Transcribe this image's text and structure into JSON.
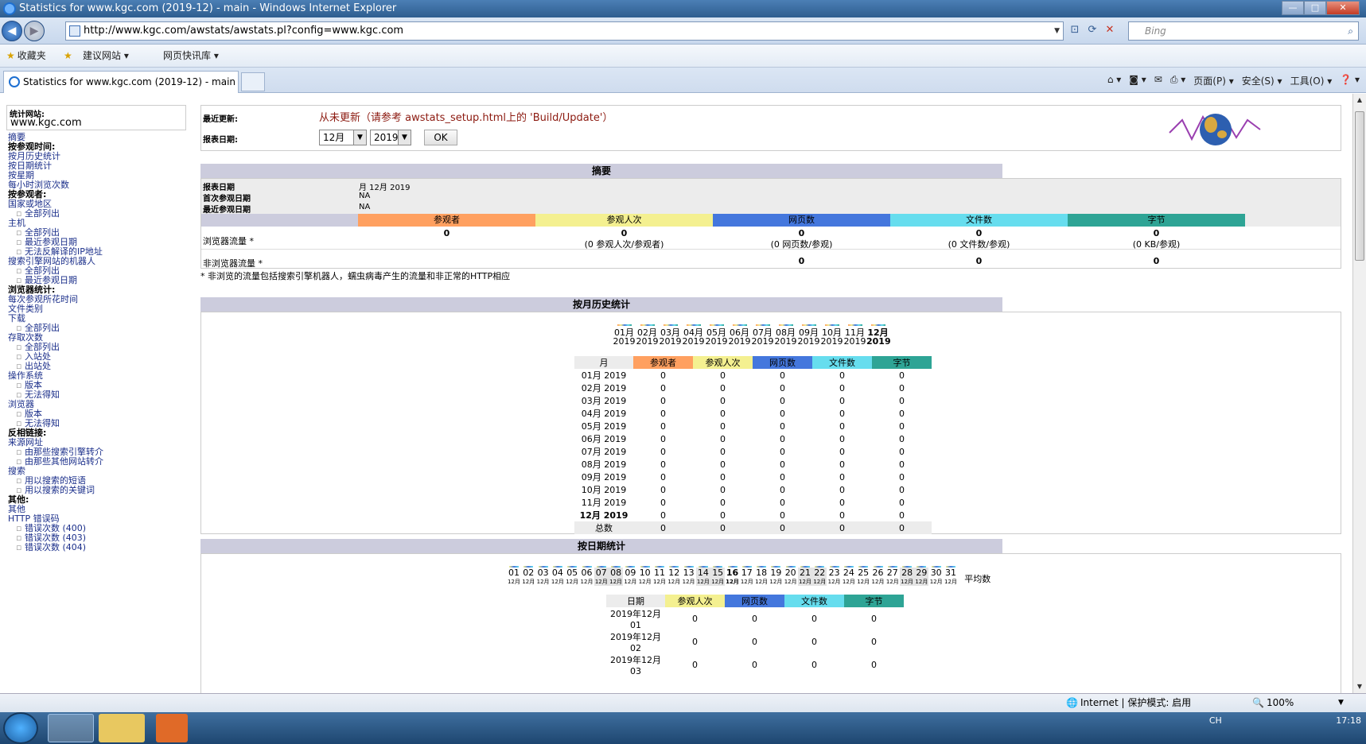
{
  "window": {
    "title": "Statistics for www.kgc.com (2019-12) - main - Windows Internet Explorer"
  },
  "address": {
    "url": "http://www.kgc.com/awstats/awstats.pl?config=www.kgc.com",
    "search_placeholder": "Bing"
  },
  "favorites": {
    "fav_label": "收藏夹",
    "suggested": "建议网站",
    "slices": "网页快讯库"
  },
  "tab": {
    "title": "Statistics for www.kgc.com (2019-12) - main"
  },
  "commands": {
    "page": "页面(P)",
    "safety": "安全(S)",
    "tools": "工具(O)"
  },
  "sidebar": {
    "site_label": "统计网站:",
    "site_value": "www.kgc.com",
    "items": [
      {
        "t": "摘要",
        "k": "l"
      },
      {
        "t": "按参观时间:",
        "k": "h"
      },
      {
        "t": "按月历史统计",
        "k": "l"
      },
      {
        "t": "按日期统计",
        "k": "l"
      },
      {
        "t": "按星期",
        "k": "l"
      },
      {
        "t": "每小时浏览次数",
        "k": "l"
      },
      {
        "t": "按参观者:",
        "k": "h"
      },
      {
        "t": "国家或地区",
        "k": "l"
      },
      {
        "t": "全部列出",
        "k": "s"
      },
      {
        "t": "主机",
        "k": "l"
      },
      {
        "t": "全部列出",
        "k": "s"
      },
      {
        "t": "最近参观日期",
        "k": "s"
      },
      {
        "t": "无法反解译的IP地址",
        "k": "s"
      },
      {
        "t": "搜索引擎网站的机器人",
        "k": "l"
      },
      {
        "t": "全部列出",
        "k": "s"
      },
      {
        "t": "最近参观日期",
        "k": "s"
      },
      {
        "t": "浏览器统计:",
        "k": "h"
      },
      {
        "t": "每次参观所花时间",
        "k": "l"
      },
      {
        "t": "文件类别",
        "k": "l"
      },
      {
        "t": "下载",
        "k": "l"
      },
      {
        "t": "全部列出",
        "k": "s"
      },
      {
        "t": "存取次数",
        "k": "l"
      },
      {
        "t": "全部列出",
        "k": "s"
      },
      {
        "t": "入站处",
        "k": "s"
      },
      {
        "t": "出站处",
        "k": "s"
      },
      {
        "t": "操作系统",
        "k": "l"
      },
      {
        "t": "版本",
        "k": "s"
      },
      {
        "t": "无法得知",
        "k": "s"
      },
      {
        "t": "浏览器",
        "k": "l"
      },
      {
        "t": "版本",
        "k": "s"
      },
      {
        "t": "无法得知",
        "k": "s"
      },
      {
        "t": "反相链接:",
        "k": "h"
      },
      {
        "t": "来源网址",
        "k": "l"
      },
      {
        "t": "由那些搜索引擎转介",
        "k": "s"
      },
      {
        "t": "由那些其他网站转介",
        "k": "s"
      },
      {
        "t": "搜索",
        "k": "l"
      },
      {
        "t": "用以搜索的短语",
        "k": "s"
      },
      {
        "t": "用以搜索的关键词",
        "k": "s"
      },
      {
        "t": "其他:",
        "k": "h"
      },
      {
        "t": "其他",
        "k": "l"
      },
      {
        "t": "HTTP 错误码",
        "k": "l"
      },
      {
        "t": "错误次数 (400)",
        "k": "s"
      },
      {
        "t": "错误次数 (403)",
        "k": "s"
      },
      {
        "t": "错误次数 (404)",
        "k": "s"
      }
    ]
  },
  "topinfo": {
    "last_update_label": "最近更新:",
    "last_update_msg": "从未更新（请参考 awstats_setup.html上的 'Build/Update'）",
    "report_date_label": "报表日期:",
    "month": "12月",
    "year": "2019",
    "ok": "OK"
  },
  "summary": {
    "heading": "摘要",
    "report_date_label": "报表日期",
    "report_date": "月 12月 2019",
    "first_visit_label": "首次参观日期",
    "first_visit": "NA",
    "last_visit_label": "最近参观日期",
    "last_visit": "NA",
    "cols": [
      "参观者",
      "参观人次",
      "网页数",
      "文件数",
      "字节"
    ],
    "viewed_label": "浏览器流量 *",
    "viewed": [
      "0",
      "0",
      "0",
      "0",
      "0"
    ],
    "viewed_sub": [
      "",
      "(0 参观人次/参观者)",
      "(0 网页数/参观)",
      "(0 文件数/参观)",
      "(0 KB/参观)"
    ],
    "notviewed_label": "非浏览器流量 *",
    "notviewed": [
      "",
      "",
      "0",
      "0",
      "0"
    ],
    "footnote": "* 非浏览的流量包括搜索引擎机器人，蠕虫病毒产生的流量和非正常的HTTP相应"
  },
  "monthly": {
    "heading": "按月历史统计",
    "chart_months": [
      "01月",
      "02月",
      "03月",
      "04月",
      "05月",
      "06月",
      "07月",
      "08月",
      "09月",
      "10月",
      "11月",
      "12月"
    ],
    "chart_year": "2019",
    "col_month": "月",
    "cols": [
      "参观者",
      "参观人次",
      "网页数",
      "文件数",
      "字节"
    ],
    "rows": [
      [
        "01月 2019",
        "0",
        "0",
        "0",
        "0",
        "0"
      ],
      [
        "02月 2019",
        "0",
        "0",
        "0",
        "0",
        "0"
      ],
      [
        "03月 2019",
        "0",
        "0",
        "0",
        "0",
        "0"
      ],
      [
        "04月 2019",
        "0",
        "0",
        "0",
        "0",
        "0"
      ],
      [
        "05月 2019",
        "0",
        "0",
        "0",
        "0",
        "0"
      ],
      [
        "06月 2019",
        "0",
        "0",
        "0",
        "0",
        "0"
      ],
      [
        "07月 2019",
        "0",
        "0",
        "0",
        "0",
        "0"
      ],
      [
        "08月 2019",
        "0",
        "0",
        "0",
        "0",
        "0"
      ],
      [
        "09月 2019",
        "0",
        "0",
        "0",
        "0",
        "0"
      ],
      [
        "10月 2019",
        "0",
        "0",
        "0",
        "0",
        "0"
      ],
      [
        "11月 2019",
        "0",
        "0",
        "0",
        "0",
        "0"
      ],
      [
        "12月 2019",
        "0",
        "0",
        "0",
        "0",
        "0"
      ],
      [
        "总数",
        "0",
        "0",
        "0",
        "0",
        "0"
      ]
    ]
  },
  "daily": {
    "heading": "按日期统计",
    "days": [
      "01",
      "02",
      "03",
      "04",
      "05",
      "06",
      "07",
      "08",
      "09",
      "10",
      "11",
      "12",
      "13",
      "14",
      "15",
      "16",
      "17",
      "18",
      "19",
      "20",
      "21",
      "22",
      "23",
      "24",
      "25",
      "26",
      "27",
      "28",
      "29",
      "30",
      "31"
    ],
    "day_sub": "12月",
    "avg_label": "平均数",
    "col_date": "日期",
    "cols": [
      "参观人次",
      "网页数",
      "文件数",
      "字节"
    ],
    "rows": [
      [
        "2019年12月01",
        "0",
        "0",
        "0",
        "0"
      ],
      [
        "2019年12月02",
        "0",
        "0",
        "0",
        "0"
      ],
      [
        "2019年12月03",
        "0",
        "0",
        "0",
        "0"
      ]
    ]
  },
  "status": {
    "zone": "Internet | 保护模式: 启用",
    "zoom": "100%"
  },
  "tray": {
    "lang": "CH",
    "time": "17:18"
  }
}
